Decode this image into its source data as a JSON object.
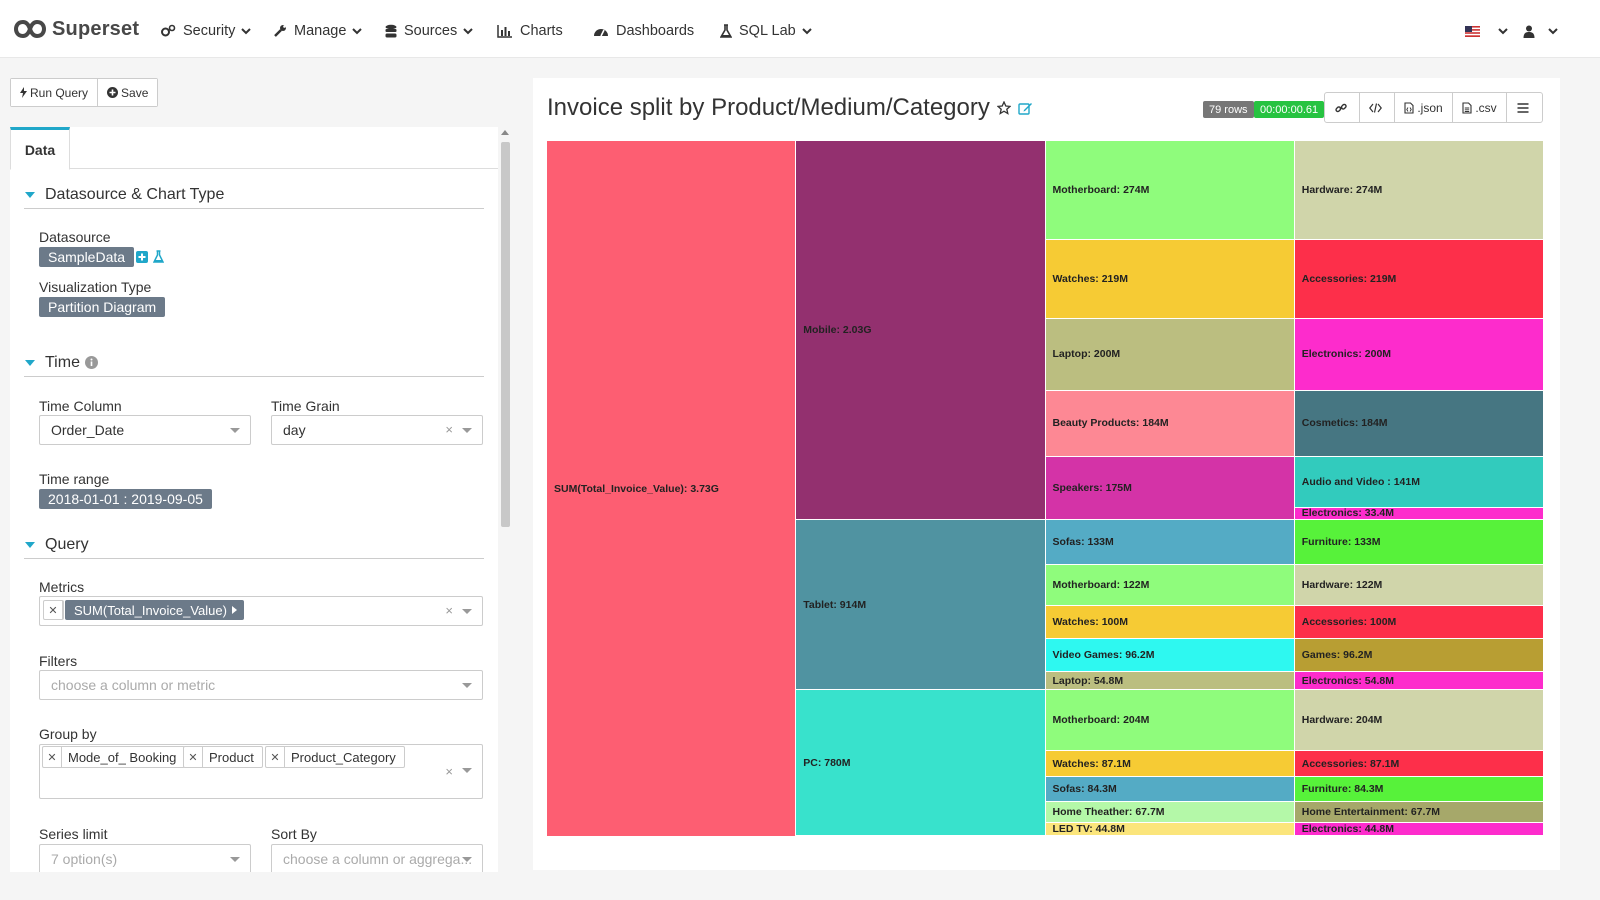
{
  "navbar": {
    "brand": "Superset",
    "items": [
      {
        "label": "Security",
        "icon": "cogs-icon"
      },
      {
        "label": "Manage",
        "icon": "wrench-icon"
      },
      {
        "label": "Sources",
        "icon": "database-icon"
      },
      {
        "label": "Charts",
        "icon": "bar-chart-icon"
      },
      {
        "label": "Dashboards",
        "icon": "dashboard-icon"
      },
      {
        "label": "SQL Lab",
        "icon": "flask-icon"
      }
    ]
  },
  "toolbar": {
    "run_query": "Run Query",
    "save": "Save"
  },
  "panel": {
    "tab": "Data",
    "sections": {
      "datasource": "Datasource & Chart Type",
      "time": "Time",
      "query": "Query"
    },
    "datasource_label": "Datasource",
    "datasource_value": "SampleData",
    "viz_type_label": "Visualization Type",
    "viz_type_value": "Partition Diagram",
    "time_column_label": "Time Column",
    "time_column_value": "Order_Date",
    "time_grain_label": "Time Grain",
    "time_grain_value": "day",
    "time_range_label": "Time range",
    "time_range_value": "2018-01-01 : 2019-09-05",
    "metrics_label": "Metrics",
    "metric_value": "SUM(Total_Invoice_Value)",
    "filters_label": "Filters",
    "filters_placeholder": "choose a column or metric",
    "groupby_label": "Group by",
    "groupby_values": [
      "Mode_of_ Booking",
      "Product",
      "Product_Category"
    ],
    "series_limit_label": "Series limit",
    "series_limit_placeholder": "7 option(s)",
    "sort_by_label": "Sort By",
    "sort_by_placeholder": "choose a column or aggrega..."
  },
  "chart_header": {
    "title": "Invoice split by Product/Medium/Category",
    "rows_badge": "79 rows",
    "time_badge": "00:00:00.61",
    "json_label": ".json",
    "csv_label": ".csv"
  },
  "colors": {
    "accent": "#20a7c9",
    "success": "#27c341"
  },
  "chart_data": {
    "type": "partition",
    "root": {
      "label": "SUM(Total_Invoice_Value): 3.73G",
      "value": 3730,
      "color": "#fd5e72"
    },
    "level1": [
      {
        "label": "Mobile: 2.03G",
        "value": 2030,
        "color": "#93306f"
      },
      {
        "label": "Tablet: 914M",
        "value": 914,
        "color": "#5093a1"
      },
      {
        "label": "PC: 780M",
        "value": 780,
        "color": "#38e2cc"
      }
    ],
    "level2": [
      {
        "parent": 0,
        "label": "Motherboard: 274M",
        "value": 274,
        "color": "#8ffc7c"
      },
      {
        "parent": 0,
        "label": "Watches: 219M",
        "value": 219,
        "color": "#f6cb34"
      },
      {
        "parent": 0,
        "label": "Laptop: 200M",
        "value": 200,
        "color": "#bbbe80"
      },
      {
        "parent": 0,
        "label": "Beauty Products: 184M",
        "value": 184,
        "color": "#fd8894"
      },
      {
        "parent": 0,
        "label": "Speakers: 175M",
        "value": 175,
        "color": "#d433a7"
      },
      {
        "parent": 1,
        "label": "Sofas: 133M",
        "value": 133,
        "color": "#54abc5"
      },
      {
        "parent": 1,
        "label": "Motherboard: 122M",
        "value": 122,
        "color": "#8ffc7c"
      },
      {
        "parent": 1,
        "label": "Watches: 100M",
        "value": 100,
        "color": "#f6cb34"
      },
      {
        "parent": 1,
        "label": "Video Games: 96.2M",
        "value": 96.2,
        "color": "#2ef8f0"
      },
      {
        "parent": 1,
        "label": "Laptop: 54.8M",
        "value": 54.8,
        "color": "#bbbe80"
      },
      {
        "parent": 2,
        "label": "Motherboard: 204M",
        "value": 204,
        "color": "#8ffc7c"
      },
      {
        "parent": 2,
        "label": "Watches: 87.1M",
        "value": 87.1,
        "color": "#f6cb34"
      },
      {
        "parent": 2,
        "label": "Sofas: 84.3M",
        "value": 84.3,
        "color": "#54abc5"
      },
      {
        "parent": 2,
        "label": "Home Theather: 67.7M",
        "value": 67.7,
        "color": "#b4f8a8"
      },
      {
        "parent": 2,
        "label": "LED TV: 44.8M",
        "value": 44.8,
        "color": "#fbe57b"
      }
    ],
    "level3": [
      {
        "parent": 0,
        "label": "Hardware: 274M",
        "value": 274,
        "color": "#d0d5aa"
      },
      {
        "parent": 1,
        "label": "Accessories: 219M",
        "value": 219,
        "color": "#fd2f4a"
      },
      {
        "parent": 2,
        "label": "Electronics: 200M",
        "value": 200,
        "color": "#fd2ccc"
      },
      {
        "parent": 3,
        "label": "Cosmetics: 184M",
        "value": 184,
        "color": "#467682"
      },
      {
        "parent": 4,
        "label": "Audio and Video : 141M",
        "value": 141,
        "color": "#32cbbd"
      },
      {
        "parent": 4,
        "label": "Electronics: 33.4M",
        "value": 33.4,
        "color": "#fd2ccc"
      },
      {
        "parent": 5,
        "label": "Furniture: 133M",
        "value": 133,
        "color": "#57f23a"
      },
      {
        "parent": 6,
        "label": "Hardware: 122M",
        "value": 122,
        "color": "#d0d5aa"
      },
      {
        "parent": 7,
        "label": "Accessories: 100M",
        "value": 100,
        "color": "#fd2f4a"
      },
      {
        "parent": 8,
        "label": "Games: 96.2M",
        "value": 96.2,
        "color": "#b89e33"
      },
      {
        "parent": 9,
        "label": "Electronics: 54.8M",
        "value": 54.8,
        "color": "#fd2ccc"
      },
      {
        "parent": 10,
        "label": "Hardware: 204M",
        "value": 204,
        "color": "#d0d5aa"
      },
      {
        "parent": 11,
        "label": "Accessories: 87.1M",
        "value": 87.1,
        "color": "#fd2f4a"
      },
      {
        "parent": 12,
        "label": "Furniture: 84.3M",
        "value": 84.3,
        "color": "#57f23a"
      },
      {
        "parent": 13,
        "label": "Home Entertainment: 67.7M",
        "value": 67.7,
        "color": "#a6a86a"
      },
      {
        "parent": 14,
        "label": "Electronics: 44.8M",
        "value": 44.8,
        "color": "#fd2ccc"
      }
    ]
  }
}
